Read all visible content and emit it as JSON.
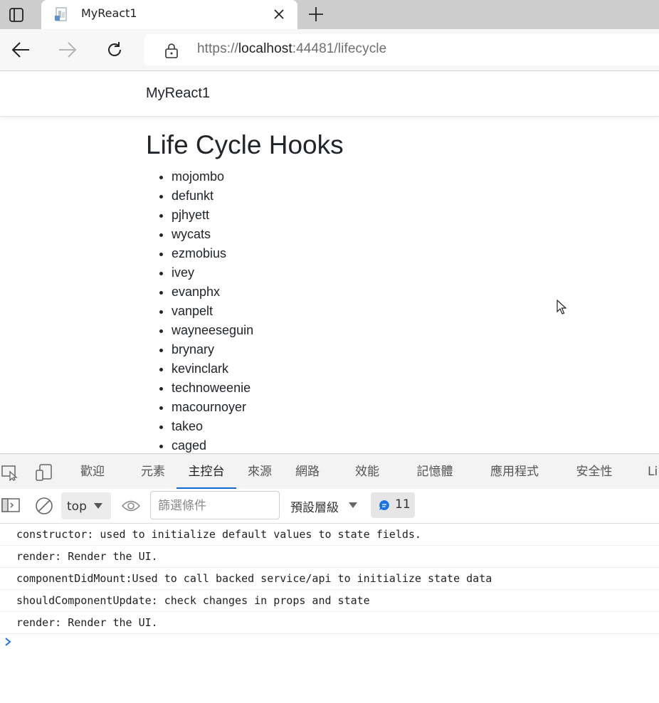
{
  "browser": {
    "tab_title": "MyReact1",
    "url_prefix": "https://",
    "url_host": "localhost",
    "url_suffix": ":44481/lifecycle"
  },
  "page": {
    "brand": "MyReact1",
    "title": "Life Cycle Hooks",
    "users": [
      "mojombo",
      "defunkt",
      "pjhyett",
      "wycats",
      "ezmobius",
      "ivey",
      "evanphx",
      "vanpelt",
      "wayneeseguin",
      "brynary",
      "kevinclark",
      "technoweenie",
      "macournoyer",
      "takeo",
      "caged"
    ]
  },
  "devtools": {
    "tabs": [
      "歡迎",
      "元素",
      "主控台",
      "來源",
      "網路",
      "效能",
      "記憶體",
      "應用程式",
      "安全性",
      "Li"
    ],
    "active_tab": "主控台",
    "context": "top",
    "filter_placeholder": "篩選條件",
    "levels": "預設層級",
    "issues_count": "11",
    "messages": [
      "constructor: used to initialize default values to state fields.",
      "render: Render the UI.",
      "componentDidMount:Used to call backed service/api to initialize state data",
      "shouldComponentUpdate: check changes in props and state",
      "render: Render the UI."
    ],
    "accent_color": "#0e6bcf"
  }
}
